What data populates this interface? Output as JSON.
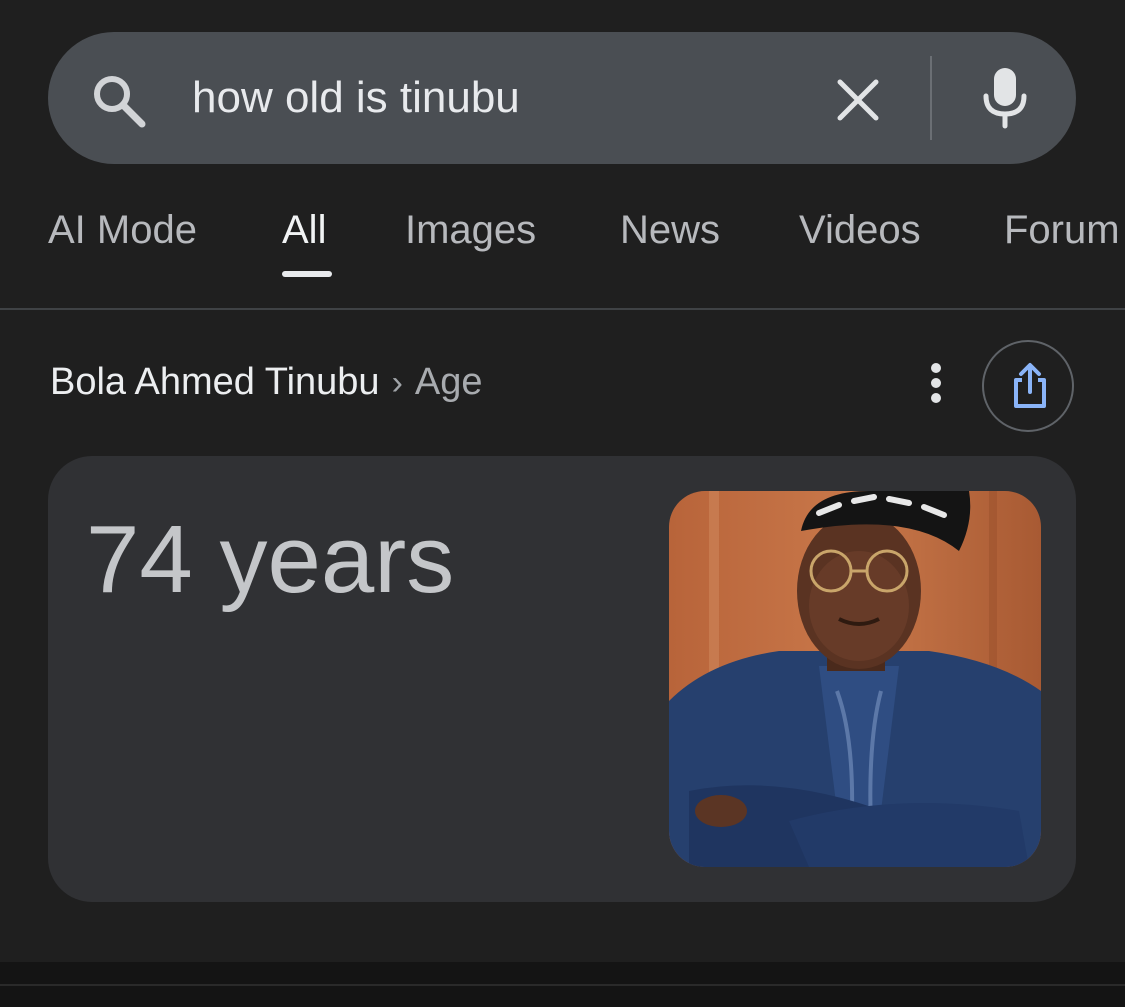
{
  "search": {
    "query": "how old is tinubu",
    "icons": {
      "search": "search-icon",
      "clear": "close-icon",
      "voice": "mic-icon"
    }
  },
  "tabs": [
    {
      "label": "AI Mode",
      "active": false
    },
    {
      "label": "All",
      "active": true
    },
    {
      "label": "Images",
      "active": false
    },
    {
      "label": "News",
      "active": false
    },
    {
      "label": "Videos",
      "active": false
    },
    {
      "label": "Forum",
      "active": false
    }
  ],
  "result": {
    "entity": "Bola Ahmed Tinubu",
    "separator": "›",
    "attribute": "Age",
    "answer": "74 years",
    "icons": {
      "more": "more-vert-icon",
      "share": "share-icon"
    }
  },
  "colors": {
    "background": "#1f1f1f",
    "search_bar": "#4a4e53",
    "card": "#303134",
    "share_accent": "#8ab4f8"
  }
}
